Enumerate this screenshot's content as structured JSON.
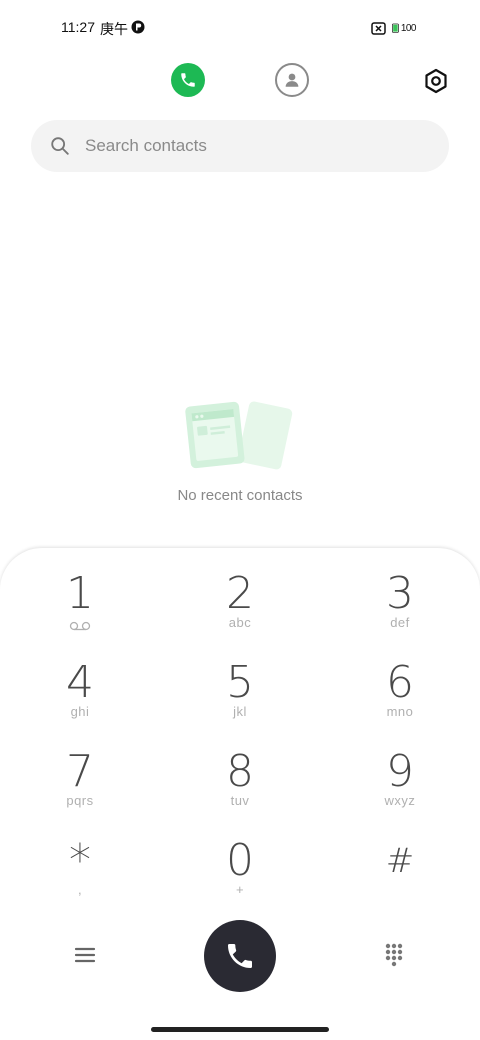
{
  "status_bar": {
    "time": "11:27",
    "extra": "庚午",
    "battery_text": "100"
  },
  "top_tabs": {
    "calls_icon": "phone-icon",
    "contacts_icon": "person-icon",
    "settings_icon": "hexagon-settings-icon"
  },
  "search": {
    "placeholder": "Search contacts"
  },
  "empty_state": {
    "text": "No recent contacts"
  },
  "dialpad": {
    "keys": [
      {
        "digit": "1",
        "letters": "ᴑᴑ"
      },
      {
        "digit": "2",
        "letters": "abc"
      },
      {
        "digit": "3",
        "letters": "def"
      },
      {
        "digit": "4",
        "letters": "ghi"
      },
      {
        "digit": "5",
        "letters": "jkl"
      },
      {
        "digit": "6",
        "letters": "mno"
      },
      {
        "digit": "7",
        "letters": "pqrs"
      },
      {
        "digit": "8",
        "letters": "tuv"
      },
      {
        "digit": "9",
        "letters": "wxyz"
      },
      {
        "digit": "*",
        "letters": ","
      },
      {
        "digit": "0",
        "letters": "+"
      },
      {
        "digit": "#",
        "letters": ""
      }
    ]
  },
  "bottom": {
    "menu_icon": "menu-icon",
    "call_icon": "phone-icon",
    "dialpad_icon": "dialpad-grid-icon"
  },
  "colors": {
    "accent": "#1db954",
    "call_button": "#2a2a33"
  }
}
